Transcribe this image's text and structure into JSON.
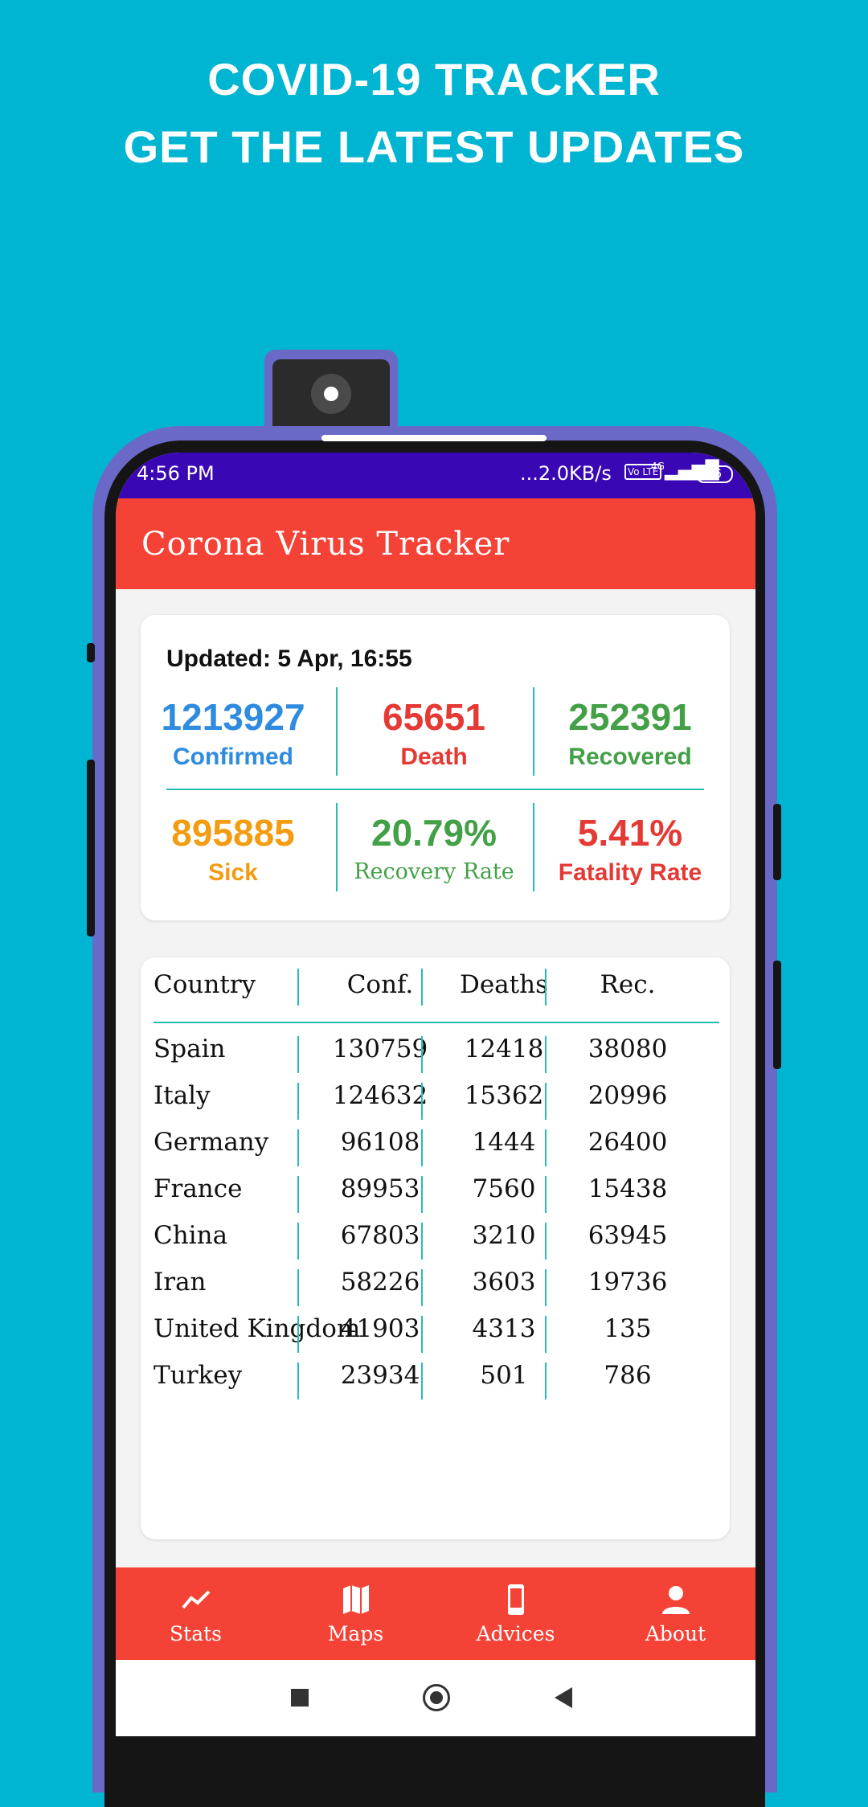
{
  "promo": {
    "line1": "COVID-19 TRACKER",
    "line2": "GET THE LATEST UPDATES"
  },
  "status_bar": {
    "time": "4:56 PM",
    "network": "...2.0KB/s",
    "lte": "Vo LTE",
    "signal": "4G",
    "battery": "36"
  },
  "app": {
    "title": "Corona Virus Tracker"
  },
  "summary": {
    "updated": "Updated: 5 Apr, 16:55",
    "confirmed": {
      "value": "1213927",
      "label": "Confirmed"
    },
    "death": {
      "value": "65651",
      "label": "Death"
    },
    "recovered": {
      "value": "252391",
      "label": "Recovered"
    },
    "sick": {
      "value": "895885",
      "label": "Sick"
    },
    "recovery_rate": {
      "value": "20.79%",
      "label": "Recovery Rate"
    },
    "fatality_rate": {
      "value": "5.41%",
      "label": "Fatality Rate"
    }
  },
  "colors": {
    "confirmed": "#2e8be0",
    "death": "#e53935",
    "recovered": "#43a047",
    "sick": "#f39c12",
    "recovery_rate": "#43a047",
    "fatality_rate": "#e53935",
    "appbar": "#f44336",
    "statusbar": "#3a07b4",
    "divider": "#26bdb4"
  },
  "table": {
    "headers": {
      "country": "Country",
      "conf": "Conf.",
      "deaths": "Deaths",
      "rec": "Rec."
    },
    "rows": [
      {
        "country": "Spain",
        "conf": "130759",
        "deaths": "12418",
        "rec": "38080"
      },
      {
        "country": "Italy",
        "conf": "124632",
        "deaths": "15362",
        "rec": "20996"
      },
      {
        "country": "Germany",
        "conf": "96108",
        "deaths": "1444",
        "rec": "26400"
      },
      {
        "country": "France",
        "conf": "89953",
        "deaths": "7560",
        "rec": "15438"
      },
      {
        "country": "China",
        "conf": "67803",
        "deaths": "3210",
        "rec": "63945"
      },
      {
        "country": "Iran",
        "conf": "58226",
        "deaths": "3603",
        "rec": "19736"
      },
      {
        "country": "United Kingdom",
        "conf": "41903",
        "deaths": "4313",
        "rec": "135"
      },
      {
        "country": "Turkey",
        "conf": "23934",
        "deaths": "501",
        "rec": "786"
      }
    ]
  },
  "bottom_nav": [
    {
      "label": "Stats",
      "icon": "trend-icon"
    },
    {
      "label": "Maps",
      "icon": "map-icon"
    },
    {
      "label": "Advices",
      "icon": "phone-icon"
    },
    {
      "label": "About",
      "icon": "person-icon"
    }
  ]
}
